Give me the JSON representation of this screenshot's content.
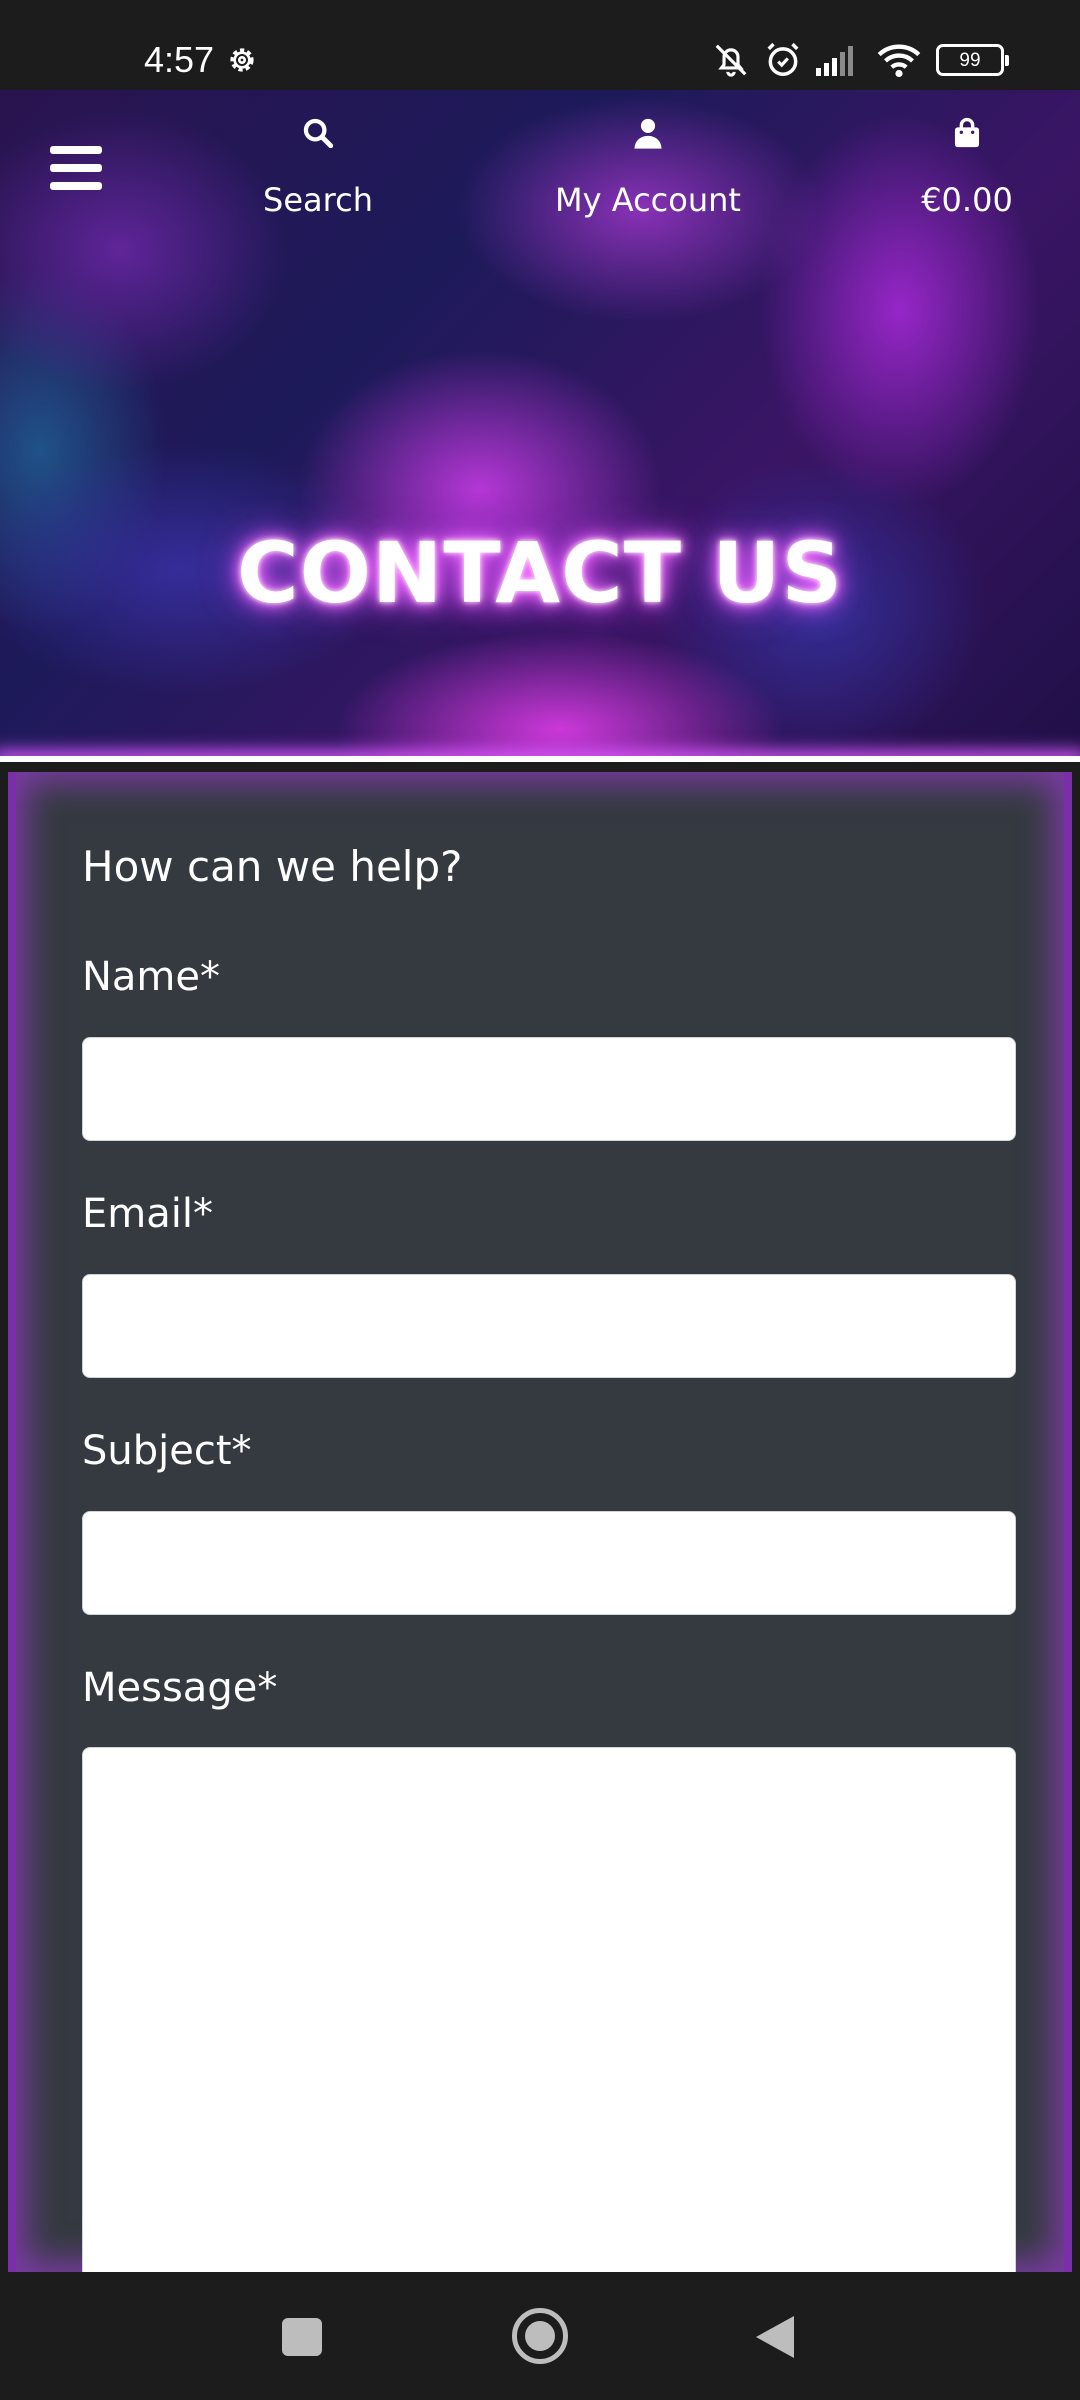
{
  "status_bar": {
    "time": "4:57",
    "battery": "99"
  },
  "header": {
    "nav": {
      "search_label": "Search",
      "account_label": "My Account",
      "cart_total": "€0.00"
    },
    "title": "CONTACT US"
  },
  "form": {
    "heading": "How can we help?",
    "fields": {
      "name": {
        "label": "Name*",
        "value": ""
      },
      "email": {
        "label": "Email*",
        "value": ""
      },
      "subject": {
        "label": "Subject*",
        "value": ""
      },
      "message": {
        "label": "Message*",
        "value": ""
      }
    }
  },
  "icons": {
    "status": [
      "gear-icon",
      "bell-off-icon",
      "alarm-icon",
      "signal-icon",
      "wifi-icon",
      "battery-icon"
    ],
    "header": [
      "menu-icon",
      "search-icon",
      "user-icon",
      "shopping-bag-icon"
    ],
    "system_nav": [
      "recents-icon",
      "home-icon",
      "back-icon"
    ]
  },
  "colors": {
    "accent_glow": "#c84bff",
    "card_background": "#343a40",
    "card_border": "#7a2fa8"
  }
}
